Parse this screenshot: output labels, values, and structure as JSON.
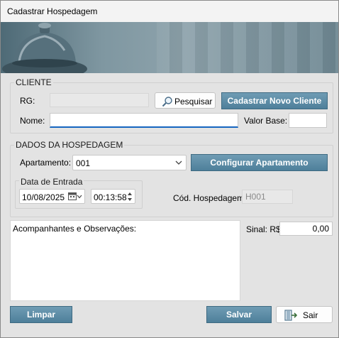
{
  "window": {
    "title": "Cadastrar Hospedagem"
  },
  "cliente": {
    "group_label": "CLIENTE",
    "rg_label": "RG:",
    "rg_value": "",
    "search_button": "Pesquisar",
    "new_client_button": "Cadastrar Novo Cliente",
    "nome_label": "Nome:",
    "nome_value": "",
    "valor_base_label": "Valor Base:",
    "valor_base_value": ""
  },
  "hospedagem": {
    "group_label": "DADOS DA HOSPEDAGEM",
    "apartamento_label": "Apartamento:",
    "apartamento_value": "001",
    "config_button": "Configurar Apartamento",
    "data_entrada_label": "Data de Entrada",
    "date_value": "10/08/2025",
    "time_value": "00:13:58",
    "cod_label": "Cód. Hospedagem:",
    "cod_value": "H001"
  },
  "observacoes": {
    "label": "Acompanhantes e Observações:",
    "value": ""
  },
  "sinal": {
    "label": "Sinal: R$",
    "value": "0,00"
  },
  "footer": {
    "limpar_button": "Limpar",
    "salvar_button": "Salvar",
    "sair_button": "Sair"
  },
  "icons": {
    "search": "magnifier-icon",
    "calendar": "calendar-icon",
    "exit": "exit-door-icon",
    "dropdown": "chevron-down-icon",
    "spinner": "spin-updown-icon"
  },
  "colors": {
    "button_blue": "#5a8aa5",
    "focus_underline": "#1565c0",
    "banner": "#7f97a1"
  }
}
